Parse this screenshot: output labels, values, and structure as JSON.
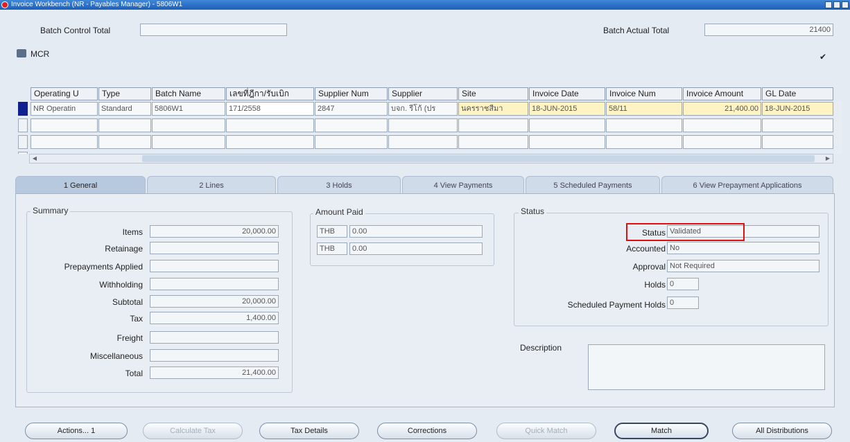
{
  "window": {
    "title": "Invoice Workbench (NR - Payables Manager) - 5806W1"
  },
  "batch": {
    "control_total_label": "Batch Control Total",
    "control_total_value": "",
    "actual_total_label": "Batch Actual Total",
    "actual_total_value": "21400"
  },
  "mcr": {
    "label": "MCR",
    "checked": "✔"
  },
  "grid": {
    "headers": [
      "Operating U",
      "Type",
      "Batch Name",
      "เลขที่ฎีกา/รับเบิก",
      "Supplier Num",
      "Supplier",
      "Site",
      "Invoice Date",
      "Invoice Num",
      "Invoice Amount",
      "GL Date"
    ],
    "rows": [
      [
        "NR Operatin",
        "Standard",
        "5806W1",
        "171/2558",
        "2847",
        "บจก. รีโก้ (ปร",
        "นครราชสีมา",
        "18-JUN-2015",
        "58/11",
        "21,400.00",
        "18-JUN-2015"
      ],
      [
        "",
        "",
        "",
        "",
        "",
        "",
        "",
        "",
        "",
        "",
        ""
      ],
      [
        "",
        "",
        "",
        "",
        "",
        "",
        "",
        "",
        "",
        "",
        ""
      ],
      [
        "",
        "",
        "",
        "",
        "",
        "",
        "",
        "",
        "",
        "",
        ""
      ]
    ]
  },
  "tabs": [
    "1 General",
    "2 Lines",
    "3 Holds",
    "4 View Payments",
    "5 Scheduled Payments",
    "6 View Prepayment Applications"
  ],
  "summary": {
    "title": "Summary",
    "rows": [
      {
        "label": "Items",
        "value": "20,000.00"
      },
      {
        "label": "Retainage",
        "value": ""
      },
      {
        "label": "Prepayments Applied",
        "value": ""
      },
      {
        "label": "Withholding",
        "value": ""
      },
      {
        "label": "Subtotal",
        "value": "20,000.00"
      },
      {
        "label": "Tax",
        "value": "1,400.00"
      },
      {
        "label": "Freight",
        "value": ""
      },
      {
        "label": "Miscellaneous",
        "value": ""
      },
      {
        "label": "Total",
        "value": "21,400.00"
      }
    ]
  },
  "amount_paid": {
    "title": "Amount Paid",
    "rows": [
      {
        "currency": "THB",
        "value": "0.00"
      },
      {
        "currency": "THB",
        "value": "0.00"
      }
    ]
  },
  "status": {
    "title": "Status",
    "rows": [
      {
        "label": "Status",
        "value": "Validated"
      },
      {
        "label": "Accounted",
        "value": "No"
      },
      {
        "label": "Approval",
        "value": "Not Required"
      },
      {
        "label": "Holds",
        "value": "0"
      },
      {
        "label": "Scheduled Payment Holds",
        "value": "0"
      }
    ]
  },
  "description": {
    "label": "Description",
    "value": ""
  },
  "buttons": {
    "actions": "Actions... 1",
    "calculate_tax": "Calculate Tax",
    "tax_details": "Tax Details",
    "corrections": "Corrections",
    "quick_match": "Quick Match",
    "match": "Match",
    "all_distributions": "All Distributions"
  },
  "colors": {
    "title_bar": "#1f5fb8",
    "highlight_box": "#e01010",
    "required_field": "#fdf3c3",
    "current_record": "#10208f"
  }
}
